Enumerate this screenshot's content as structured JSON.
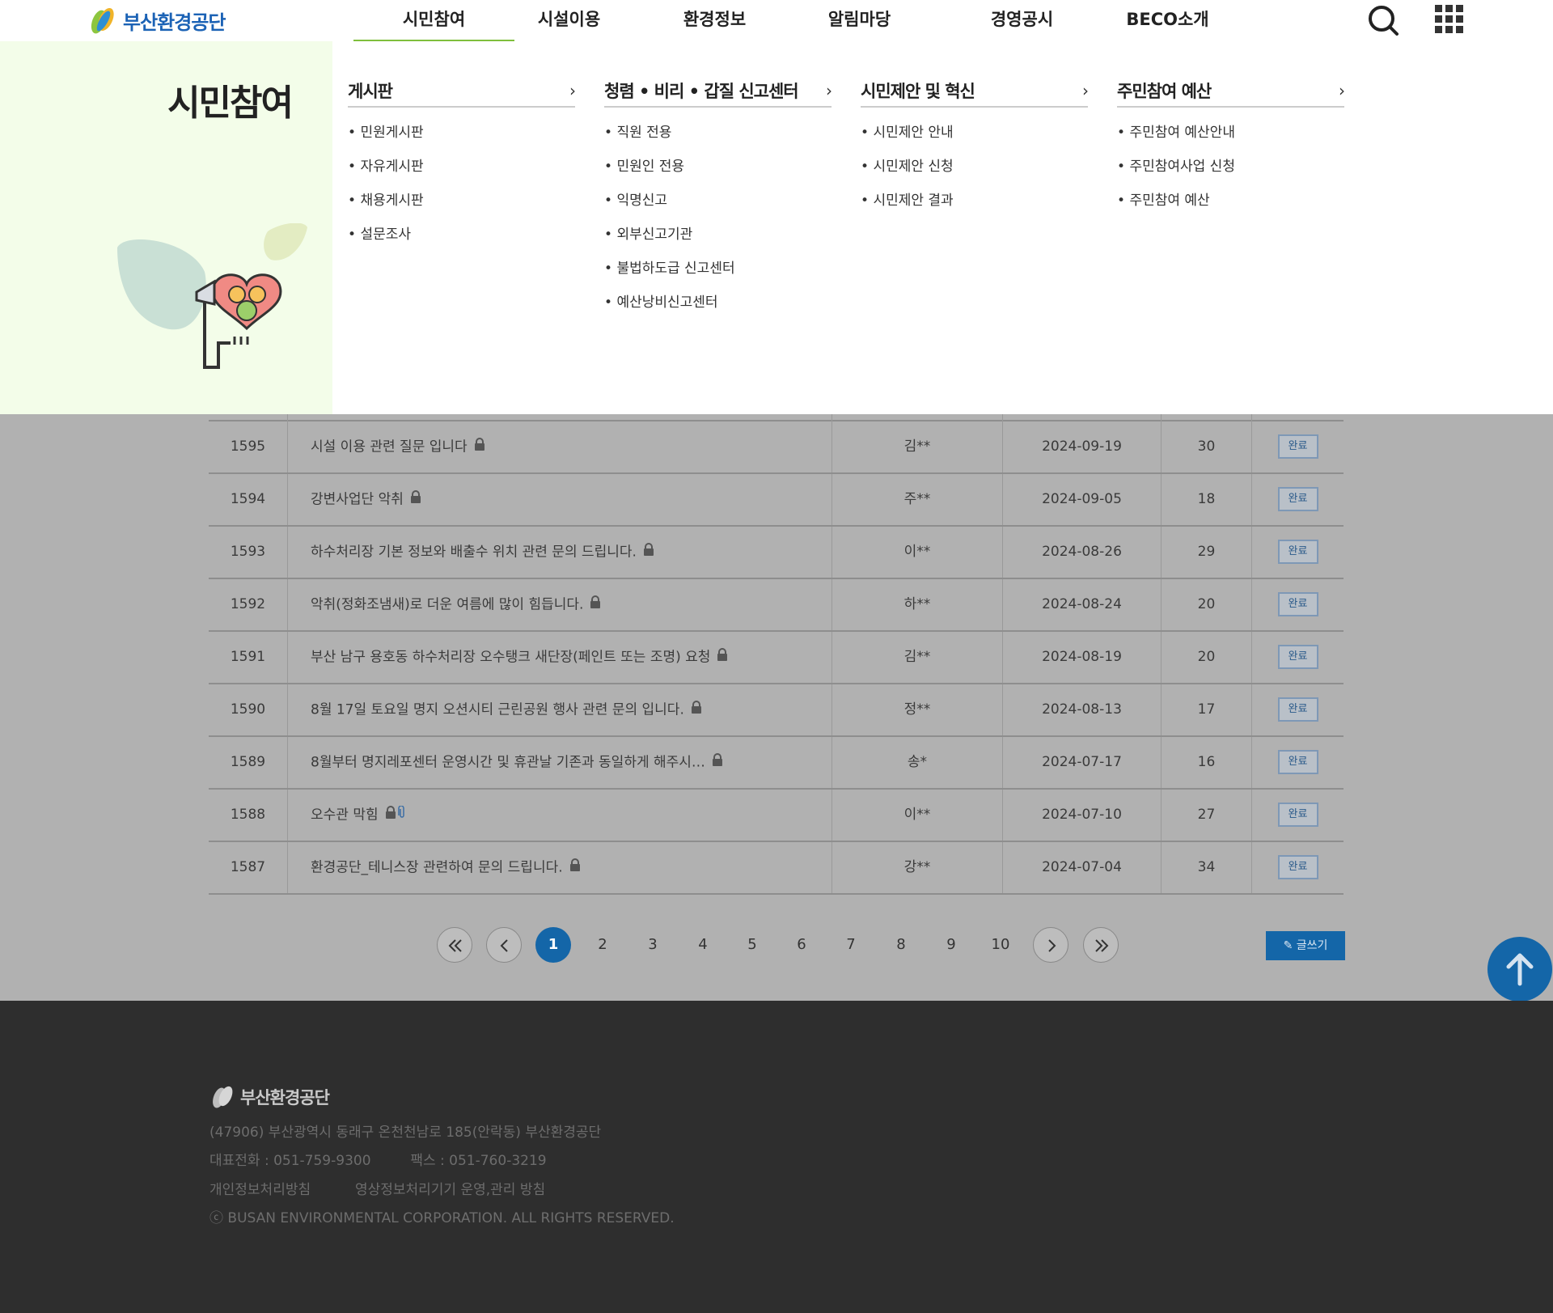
{
  "header": {
    "logo_text": "부산환경공단",
    "nav": [
      "시민참여",
      "시설이용",
      "환경정보",
      "알림마당",
      "경영공시",
      "BECO소개"
    ],
    "active_nav": "시민참여"
  },
  "mega": {
    "title": "시민참여",
    "columns": [
      {
        "title": "게시판",
        "links": [
          "민원게시판",
          "자유게시판",
          "채용게시판",
          "설문조사"
        ]
      },
      {
        "title": "청렴 • 비리 • 갑질 신고센터",
        "links": [
          "직원 전용",
          "민원인 전용",
          "익명신고",
          "외부신고기관",
          "불법하도급 신고센터",
          "예산낭비신고센터"
        ]
      },
      {
        "title": "시민제안 및 혁신",
        "links": [
          "시민제안 안내",
          "시민제안 신청",
          "시민제안 결과"
        ]
      },
      {
        "title": "주민참여 예산",
        "links": [
          "주민참여 예산안내",
          "주민참여사업 신청",
          "주민참여 예산"
        ]
      }
    ]
  },
  "board": {
    "rows": [
      {
        "no": "1595",
        "title": "시설 이용 관련 질문 입니다",
        "writer": "김**",
        "date": "2024-09-19",
        "views": "30",
        "status": "완료",
        "attach": false
      },
      {
        "no": "1594",
        "title": "강변사업단 악취",
        "writer": "주**",
        "date": "2024-09-05",
        "views": "18",
        "status": "완료",
        "attach": false
      },
      {
        "no": "1593",
        "title": "하수처리장 기본 정보와 배출수 위치 관련 문의 드립니다.",
        "writer": "이**",
        "date": "2024-08-26",
        "views": "29",
        "status": "완료",
        "attach": false
      },
      {
        "no": "1592",
        "title": "악취(정화조냄새)로 더운 여름에 많이 힘듭니다.",
        "writer": "하**",
        "date": "2024-08-24",
        "views": "20",
        "status": "완료",
        "attach": false
      },
      {
        "no": "1591",
        "title": "부산 남구 용호동 하수처리장 오수탱크 새단장(페인트 또는 조명) 요청",
        "writer": "김**",
        "date": "2024-08-19",
        "views": "20",
        "status": "완료",
        "attach": false
      },
      {
        "no": "1590",
        "title": "8월 17일 토요일 명지 오션시티 근린공원 행사 관련 문의 입니다.",
        "writer": "정**",
        "date": "2024-08-13",
        "views": "17",
        "status": "완료",
        "attach": false
      },
      {
        "no": "1589",
        "title": "8월부터 명지레포센터 운영시간 및 휴관날 기존과 동일하게 해주시…",
        "writer": "송*",
        "date": "2024-07-17",
        "views": "16",
        "status": "완료",
        "attach": false
      },
      {
        "no": "1588",
        "title": "오수관 막힘",
        "writer": "이**",
        "date": "2024-07-10",
        "views": "27",
        "status": "완료",
        "attach": true
      },
      {
        "no": "1587",
        "title": "환경공단_테니스장 관련하여 문의 드립니다.",
        "writer": "강**",
        "date": "2024-07-04",
        "views": "34",
        "status": "완료",
        "attach": false
      }
    ]
  },
  "pagination": {
    "pages": [
      "1",
      "2",
      "3",
      "4",
      "5",
      "6",
      "7",
      "8",
      "9",
      "10"
    ],
    "current": "1",
    "write_label": "글쓰기"
  },
  "footer": {
    "logo_text": "부산환경공단",
    "address": "(47906) 부산광역시 동래구 온천천남로 185(안락동) 부산환경공단",
    "phone": "대표전화 : 051-759-9300",
    "fax": "팩스 : 051-760-3219",
    "privacy_link": "개인정보처리방침",
    "cctv_link": "영상정보처리기기 운영,관리 방침",
    "copyright": "ⓒ BUSAN ENVIRONMENTAL CORPORATION. ALL RIGHTS RESERVED."
  },
  "colors": {
    "brand_blue": "#1466a8",
    "accent_green": "#7fbf3c",
    "mega_left_bg": "#f3fde9",
    "footer_bg": "#2e2e2e"
  }
}
